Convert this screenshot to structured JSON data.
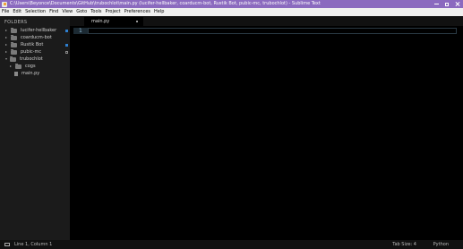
{
  "window": {
    "title": "C:\\Users\\Beyonce\\Documents\\GitHub\\trubochlot\\main.py (lucifer-hellbaker, coarducm-bot, Rustik Bot, pubic-mc, trubochlot) - Sublime Text"
  },
  "menu": [
    "File",
    "Edit",
    "Selection",
    "Find",
    "View",
    "Goto",
    "Tools",
    "Project",
    "Preferences",
    "Help"
  ],
  "sidebar": {
    "header": "FOLDERS",
    "items": [
      {
        "label": "lucifer-hellbaker",
        "type": "folder",
        "expanded": false,
        "badge": "modified"
      },
      {
        "label": "coarducm-bot",
        "type": "folder",
        "expanded": false,
        "badge": "none"
      },
      {
        "label": "Rustik Bot",
        "type": "folder",
        "expanded": false,
        "badge": "modified"
      },
      {
        "label": "pubic-mc",
        "type": "folder",
        "expanded": false,
        "badge": "untracked"
      },
      {
        "label": "trubochlot",
        "type": "folder",
        "expanded": true,
        "badge": "none"
      },
      {
        "label": "cogs",
        "type": "folder",
        "expanded": false,
        "badge": "none"
      },
      {
        "label": "main.py",
        "type": "file",
        "badge": "none"
      }
    ]
  },
  "tabs": [
    {
      "label": "main.py",
      "active": true
    }
  ],
  "editor": {
    "line_numbers": [
      "1"
    ]
  },
  "status": {
    "position": "Line 1, Column 1",
    "tab_size": "Tab Size: 4",
    "syntax": "Python"
  },
  "colors": {
    "titlebar": "#8b6abf",
    "badge_blue": "#2e7fcf",
    "editor_bg": "#000000",
    "sidebar_bg": "#1b1b1b"
  }
}
